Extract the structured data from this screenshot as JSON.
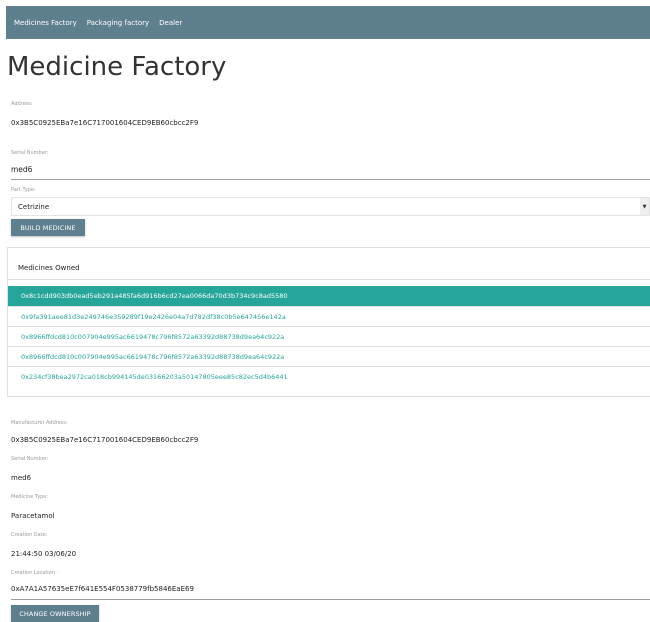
{
  "nav": [
    "Medicines Factory",
    "Packaging factory",
    "Dealer"
  ],
  "page_title": "Medicine Factory",
  "address": {
    "label": "Address:",
    "value": "0x3B5C0925EBa7e16C717001604CED9EB60cbcc2F9"
  },
  "serial": {
    "label": "Serial Number:",
    "value": "med6"
  },
  "part_type": {
    "label": "Part Type:",
    "value": "Cetrizine",
    "arrow": "▼"
  },
  "build_button": "BUILD MEDICINE",
  "medicines_owned": {
    "title": "Medicines Owned",
    "items": [
      "0x8c1cdd903db0ead5eb291a485fa6d916b6cd27ea0066da70d3b734c9c8ad5580",
      "0x9fa391aee81d3e249746e359289f19e2426e04a7d782df38c0b5e647456e142a",
      "0x8966ffdcd810c007904e995ac6619478c796f8572a63392d88738d9ea64c922a",
      "0x8966ffdcd810c007904e995ac6619478c796f8572a63392d88738d9ea64c922a",
      "0x234cf38bea2972ca018cb994145de03166203a50147805eee85c82ec5d4b6441"
    ]
  },
  "details": {
    "manufacturer_label": "Manufacturer Address:",
    "manufacturer_value": "0x3B5C0925EBa7e16C717001604CED9EB60cbcc2F9",
    "serial_label": "Serial Number:",
    "serial_value": "med6",
    "type_label": "Medicine Type:",
    "type_value": "Paracetamol",
    "date_label": "Creation Date:",
    "date_value": "21:44:50 03/06/20",
    "location_label": "Creation Location :",
    "location_value": "0xA7A1A57635eE7f641E554F0538779fb5846EaE69"
  },
  "change_button": "CHANGE OWNERSHIP"
}
